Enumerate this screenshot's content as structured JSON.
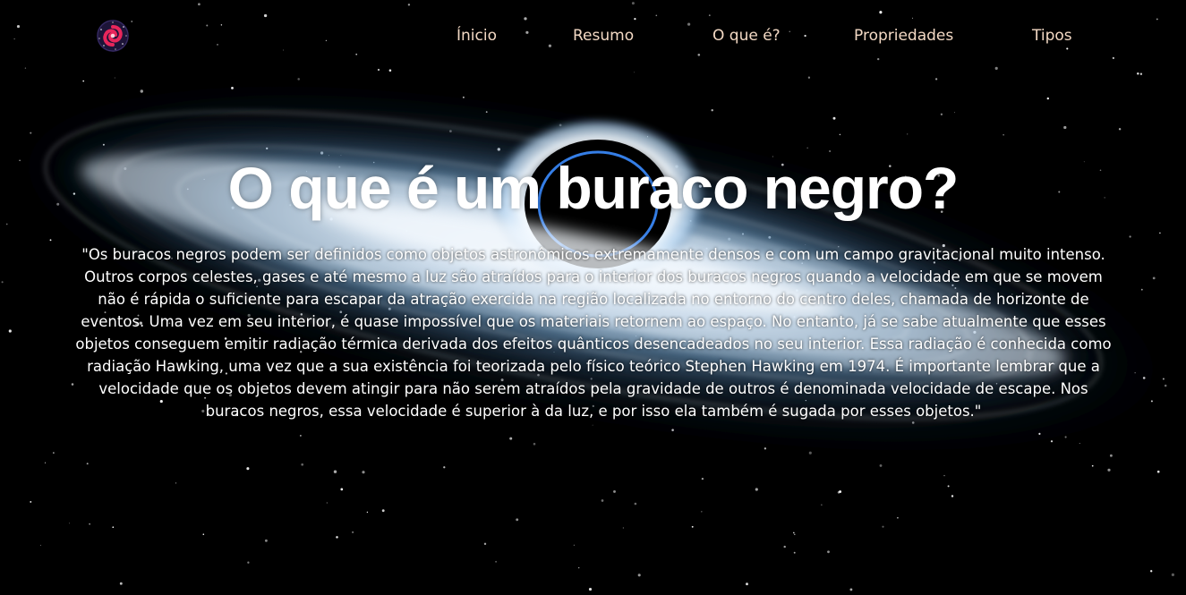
{
  "nav": {
    "logo_icon": "galaxy-icon",
    "items": [
      {
        "label": "Ínicio"
      },
      {
        "label": "Resumo"
      },
      {
        "label": "O que é?"
      },
      {
        "label": "Propriedades"
      },
      {
        "label": "Tipos"
      }
    ]
  },
  "hero": {
    "title": "O que é um buraco negro?",
    "text": "\"Os buracos negros podem ser definidos como objetos astronômicos extremamente densos e com um campo gravitacional muito intenso. Outros corpos celestes, gases e até mesmo a luz são atraídos para o interior dos buracos negros quando a velocidade em que se movem não é rápida o suficiente para escapar da atração exercida na região localizada no entorno do centro deles, chamada de horizonte de eventos. Uma vez em seu interior, é quase impossível que os materiais retornem ao espaço. No entanto, já se sabe atualmente que esses objetos conseguem emitir radiação térmica derivada dos efeitos quânticos desencadeados no seu interior. Essa radiação é conhecida como radiação Hawking, uma vez que a sua existência foi teorizada pelo físico teórico Stephen Hawking em 1974. É importante lembrar que a velocidade que os objetos devem atingir para não serem atraídos pela gravidade de outros é denominada velocidade de escape. Nos buracos negros, essa velocidade é superior à da luz, e por isso ela também é sugada por esses objetos.\""
  },
  "colors": {
    "background": "#000000",
    "nav_text": "#f3d9c4",
    "title": "#ffffff",
    "disk_glow": "#bfe3ff",
    "photon_ring": "#3b8cff",
    "logo_pink": "#e8265b"
  }
}
